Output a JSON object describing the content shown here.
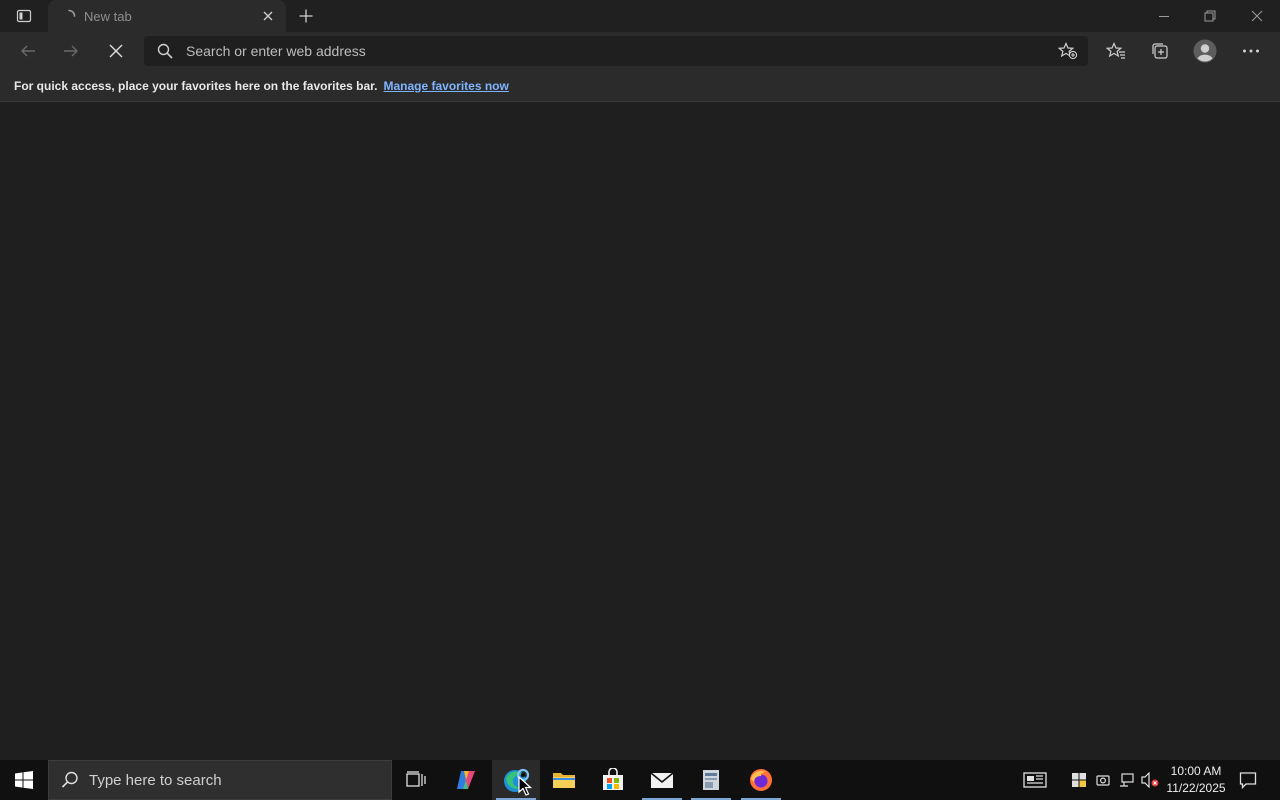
{
  "browser": {
    "tab": {
      "title": "New tab"
    },
    "address": {
      "placeholder": "Search or enter web address",
      "value": ""
    },
    "favorites_bar": {
      "message": "For quick access, place your favorites here on the favorites bar.",
      "link": "Manage favorites now"
    }
  },
  "taskbar": {
    "search_placeholder": "Type here to search",
    "clock": {
      "time": "10:00 AM",
      "date": "11/22/2025"
    }
  },
  "colors": {
    "accent": "#7fb4ff",
    "background": "#1f1f1f",
    "toolbar": "#2b2b2b",
    "taskbar": "#101010"
  }
}
